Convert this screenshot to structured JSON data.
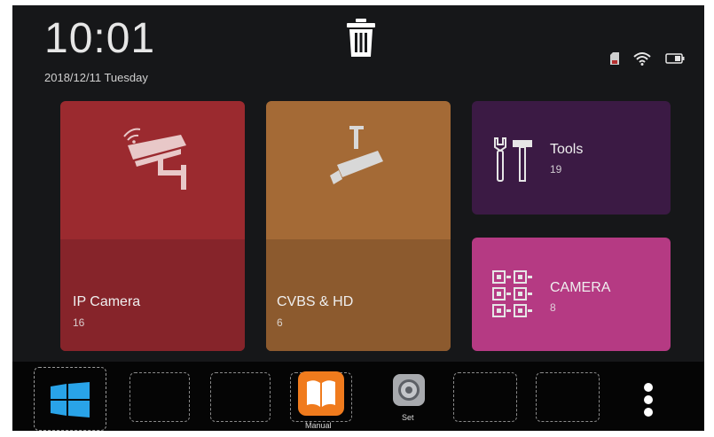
{
  "status": {
    "time": "10:01",
    "date": "2018/12/11 Tuesday"
  },
  "tiles": [
    {
      "label": "IP Camera",
      "count": "16",
      "color": "#9b2a2f"
    },
    {
      "label": "CVBS & HD",
      "count": "6",
      "color": "#a46a36"
    },
    {
      "label": "Tools",
      "count": "19",
      "color": "#3b1a44"
    },
    {
      "label": "CAMERA",
      "count": "8",
      "color": "#b53a83"
    }
  ],
  "dock": {
    "manual_label": "Manual",
    "set_label": "Set"
  },
  "icons": [
    "trash-icon",
    "sd-card-icon",
    "wifi-icon",
    "battery-icon",
    "windows-icon",
    "book-icon",
    "settings-icon",
    "more-vertical-icon"
  ]
}
